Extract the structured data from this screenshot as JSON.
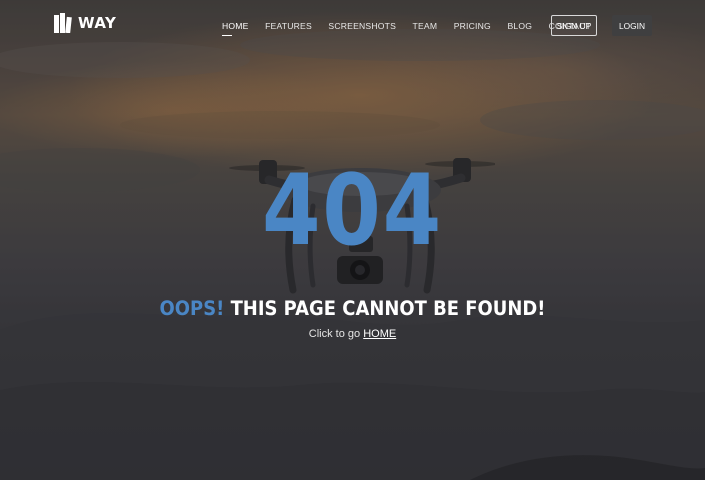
{
  "logo": {
    "icon": "books-logo-icon",
    "text": "WAY"
  },
  "nav": {
    "items": [
      {
        "label": "HOME",
        "active": true
      },
      {
        "label": "FEATURES",
        "active": false
      },
      {
        "label": "SCREENSHOTS",
        "active": false
      },
      {
        "label": "TEAM",
        "active": false
      },
      {
        "label": "PRICING",
        "active": false
      },
      {
        "label": "BLOG",
        "active": false
      },
      {
        "label": "CONTACT",
        "active": false
      }
    ],
    "signup_label": "SIGN UP",
    "login_label": "LOGIN"
  },
  "error": {
    "code": "404",
    "oops": "OOPS!",
    "message": "THIS PAGE CANNOT BE FOUND!",
    "prompt": "Click to go",
    "home_link": "HOME"
  },
  "colors": {
    "accent": "#4a86c5",
    "text": "#ffffff",
    "login_bg": "#3f3f40"
  },
  "background": {
    "description_icon": "drone-sunset-photo"
  }
}
